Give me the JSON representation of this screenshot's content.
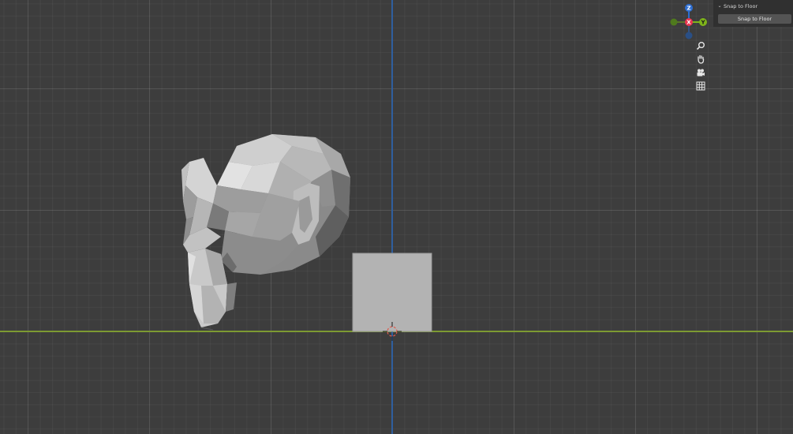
{
  "operator_panel": {
    "header_label": "Snap to Floor",
    "button_label": "Snap to Floor"
  },
  "navigation_gizmo": {
    "axes": [
      {
        "label": "Z",
        "color": "#2e6ed1"
      },
      {
        "label": "X",
        "color": "#e8354f"
      },
      {
        "label": "Y",
        "color": "#7fb51a"
      }
    ]
  },
  "viewport_tools": [
    {
      "name": "zoom",
      "icon": "magnifier-icon"
    },
    {
      "name": "pan",
      "icon": "hand-icon"
    },
    {
      "name": "camera",
      "icon": "camera-icon"
    },
    {
      "name": "perspective",
      "icon": "grid-icon"
    }
  ],
  "colors": {
    "viewport_bg": "#3d3d3d",
    "x_axis_line": "#7d9a32",
    "z_axis_line": "#2f5f9e",
    "mesh": "#b3b3b3",
    "panel_bg": "#303030",
    "button_bg": "#545454"
  }
}
